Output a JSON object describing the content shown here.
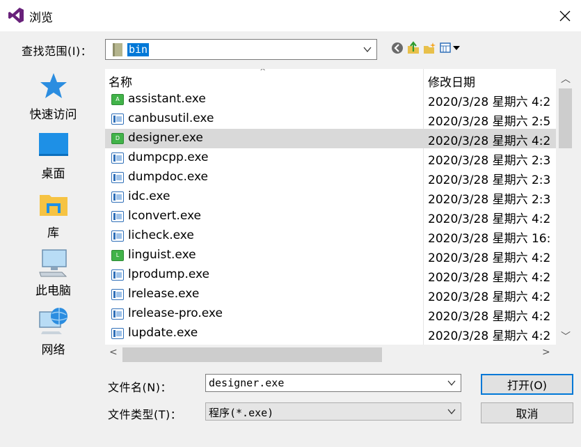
{
  "window": {
    "title": "浏览",
    "close_glyph": "✕"
  },
  "lookin": {
    "label": "查找范围(I)：",
    "value": "bin"
  },
  "toolbar": {
    "icons": [
      "back-icon",
      "up-folder-icon",
      "new-folder-icon",
      "view-menu-icon"
    ]
  },
  "places": [
    {
      "label": "快速访问",
      "icon": "star-icon"
    },
    {
      "label": "桌面",
      "icon": "desktop-icon"
    },
    {
      "label": "库",
      "icon": "library-icon"
    },
    {
      "label": "此电脑",
      "icon": "computer-icon"
    },
    {
      "label": "网络",
      "icon": "network-icon"
    }
  ],
  "filelist": {
    "columns": {
      "name": "名称",
      "date": "修改日期"
    },
    "rows": [
      {
        "name": "assistant.exe",
        "date": "2020/3/28 星期六 4:2",
        "icon": "qt",
        "letter": "A",
        "selected": false
      },
      {
        "name": "canbusutil.exe",
        "date": "2020/3/28 星期六 2:5",
        "icon": "win",
        "selected": false
      },
      {
        "name": "designer.exe",
        "date": "2020/3/28 星期六 4:2",
        "icon": "qt",
        "letter": "D",
        "selected": true
      },
      {
        "name": "dumpcpp.exe",
        "date": "2020/3/28 星期六 2:3",
        "icon": "win",
        "selected": false
      },
      {
        "name": "dumpdoc.exe",
        "date": "2020/3/28 星期六 2:3",
        "icon": "win",
        "selected": false
      },
      {
        "name": "idc.exe",
        "date": "2020/3/28 星期六 2:3",
        "icon": "win",
        "selected": false
      },
      {
        "name": "lconvert.exe",
        "date": "2020/3/28 星期六 4:2",
        "icon": "win",
        "selected": false
      },
      {
        "name": "licheck.exe",
        "date": "2020/3/28 星期六 16:",
        "icon": "win",
        "selected": false
      },
      {
        "name": "linguist.exe",
        "date": "2020/3/28 星期六 4:2",
        "icon": "qt",
        "letter": "L",
        "selected": false
      },
      {
        "name": "lprodump.exe",
        "date": "2020/3/28 星期六 4:2",
        "icon": "win",
        "selected": false
      },
      {
        "name": "lrelease.exe",
        "date": "2020/3/28 星期六 4:2",
        "icon": "win",
        "selected": false
      },
      {
        "name": "lrelease-pro.exe",
        "date": "2020/3/28 星期六 4:2",
        "icon": "win",
        "selected": false
      },
      {
        "name": "lupdate.exe",
        "date": "2020/3/28 星期六 4:2",
        "icon": "win",
        "selected": false
      }
    ]
  },
  "filename": {
    "label": "文件名(N)：",
    "value": "designer.exe"
  },
  "filetype": {
    "label": "文件类型(T)：",
    "value": "程序(*.exe)"
  },
  "buttons": {
    "open": "打开(O)",
    "cancel": "取消"
  },
  "colors": {
    "accent": "#0078d7",
    "selection": "#d9d9d9",
    "qt_green": "#41b349",
    "vs_purple": "#68217a"
  }
}
